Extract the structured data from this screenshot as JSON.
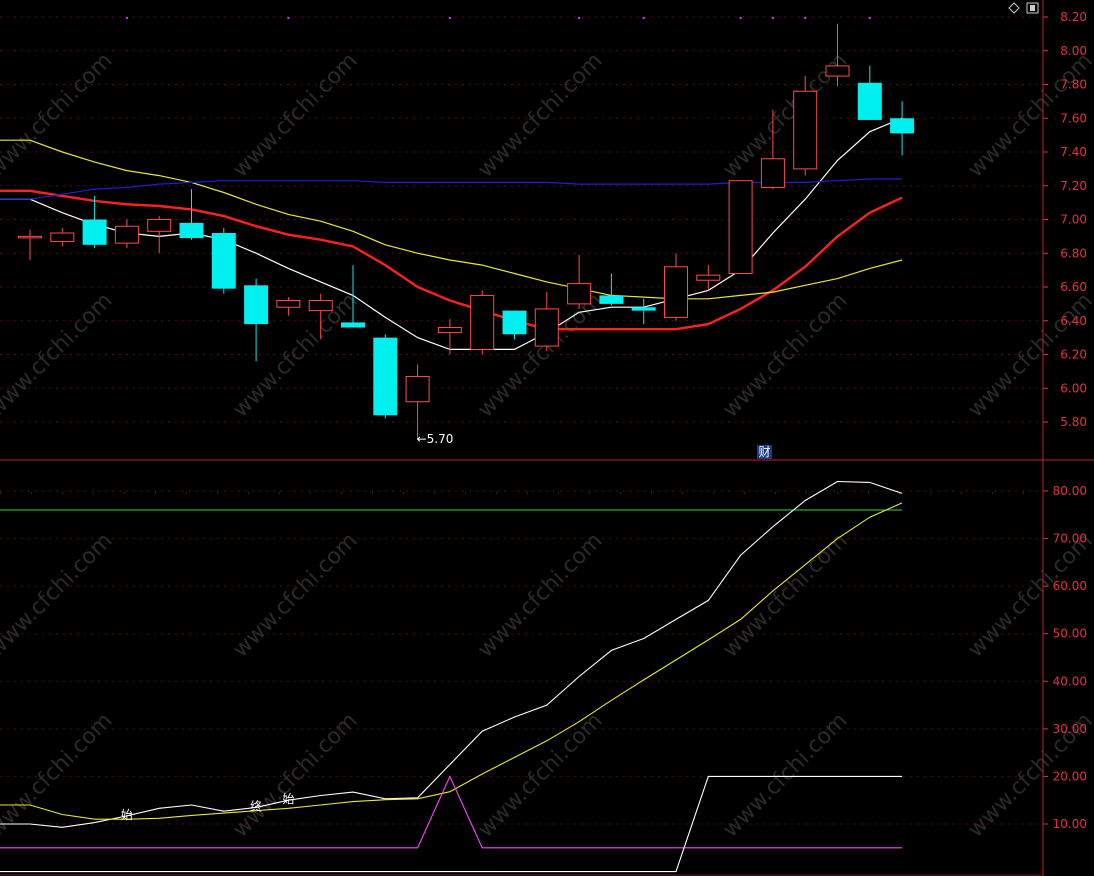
{
  "toolbar": {
    "icons": [
      "diamond-icon",
      "copy-icon"
    ]
  },
  "watermark": "www.cfchi.com",
  "chart_data": [
    {
      "type": "candlestick",
      "panel": "price",
      "ylim": [
        5.62,
        8.25
      ],
      "yticks": [
        "8.20",
        "8.00",
        "7.80",
        "7.60",
        "7.40",
        "7.20",
        "7.00",
        "6.80",
        "6.60",
        "6.40",
        "6.20",
        "6.00",
        "5.80"
      ],
      "candles": [
        {
          "o": 6.9,
          "h": 6.94,
          "l": 6.76,
          "c": 6.9
        },
        {
          "o": 6.87,
          "h": 6.95,
          "l": 6.84,
          "c": 6.92
        },
        {
          "o": 7.0,
          "h": 7.14,
          "l": 6.83,
          "c": 6.85
        },
        {
          "o": 6.86,
          "h": 7.0,
          "l": 6.83,
          "c": 6.96
        },
        {
          "o": 6.93,
          "h": 7.02,
          "l": 6.8,
          "c": 7.0
        },
        {
          "o": 6.98,
          "h": 7.18,
          "l": 6.88,
          "c": 6.89
        },
        {
          "o": 6.92,
          "h": 6.95,
          "l": 6.56,
          "c": 6.59
        },
        {
          "o": 6.61,
          "h": 6.65,
          "l": 6.16,
          "c": 6.38
        },
        {
          "o": 6.48,
          "h": 6.54,
          "l": 6.43,
          "c": 6.52
        },
        {
          "o": 6.46,
          "h": 6.56,
          "l": 6.29,
          "c": 6.52
        },
        {
          "o": 6.39,
          "h": 6.73,
          "l": 6.36,
          "c": 6.36
        },
        {
          "o": 6.3,
          "h": 6.32,
          "l": 5.82,
          "c": 5.84
        },
        {
          "o": 5.92,
          "h": 6.14,
          "l": 5.7,
          "c": 6.07
        },
        {
          "o": 6.33,
          "h": 6.41,
          "l": 6.2,
          "c": 6.36
        },
        {
          "o": 6.23,
          "h": 6.58,
          "l": 6.2,
          "c": 6.55
        },
        {
          "o": 6.46,
          "h": 6.46,
          "l": 6.29,
          "c": 6.32
        },
        {
          "o": 6.25,
          "h": 6.57,
          "l": 6.22,
          "c": 6.47
        },
        {
          "o": 6.5,
          "h": 6.79,
          "l": 6.47,
          "c": 6.62
        },
        {
          "o": 6.55,
          "h": 6.68,
          "l": 6.49,
          "c": 6.5
        },
        {
          "o": 6.48,
          "h": 6.53,
          "l": 6.38,
          "c": 6.46
        },
        {
          "o": 6.42,
          "h": 6.8,
          "l": 6.4,
          "c": 6.72
        },
        {
          "o": 6.64,
          "h": 6.73,
          "l": 6.58,
          "c": 6.67
        },
        {
          "o": 6.68,
          "h": 7.23,
          "l": 6.68,
          "c": 7.23
        },
        {
          "o": 7.19,
          "h": 7.65,
          "l": 7.18,
          "c": 7.36
        },
        {
          "o": 7.3,
          "h": 7.85,
          "l": 7.26,
          "c": 7.76
        },
        {
          "o": 7.85,
          "h": 8.16,
          "l": 7.79,
          "c": 7.91
        },
        {
          "o": 7.81,
          "h": 7.91,
          "l": 7.59,
          "c": 7.59
        },
        {
          "o": 7.6,
          "h": 7.7,
          "l": 7.38,
          "c": 7.51
        }
      ],
      "series": [
        {
          "color": "#ffffff",
          "values": [
            7.12,
            7.04,
            6.97,
            6.92,
            6.9,
            6.92,
            6.88,
            6.8,
            6.71,
            6.63,
            6.55,
            6.42,
            6.3,
            6.23,
            6.23,
            6.23,
            6.33,
            6.45,
            6.48,
            6.48,
            6.53,
            6.58,
            6.7,
            6.92,
            7.12,
            7.35,
            7.52,
            7.6
          ]
        },
        {
          "color": "#ff2020",
          "values": [
            7.17,
            7.14,
            7.11,
            7.09,
            7.08,
            7.06,
            7.02,
            6.96,
            6.91,
            6.88,
            6.84,
            6.73,
            6.6,
            6.52,
            6.46,
            6.4,
            6.35,
            6.35,
            6.35,
            6.35,
            6.35,
            6.38,
            6.47,
            6.58,
            6.72,
            6.9,
            7.04,
            7.13
          ]
        },
        {
          "color": "#e6e63a",
          "values": [
            7.47,
            7.4,
            7.34,
            7.29,
            7.26,
            7.22,
            7.16,
            7.09,
            7.03,
            6.99,
            6.93,
            6.85,
            6.8,
            6.76,
            6.73,
            6.68,
            6.63,
            6.59,
            6.55,
            6.54,
            6.53,
            6.53,
            6.55,
            6.57,
            6.61,
            6.65,
            6.71,
            6.76
          ]
        },
        {
          "color": "#1e1ed2",
          "values": [
            7.12,
            7.15,
            7.18,
            7.19,
            7.21,
            7.22,
            7.23,
            7.23,
            7.23,
            7.23,
            7.23,
            7.22,
            7.22,
            7.22,
            7.22,
            7.22,
            7.22,
            7.21,
            7.21,
            7.21,
            7.21,
            7.21,
            7.22,
            7.22,
            7.22,
            7.23,
            7.24,
            7.24
          ]
        }
      ],
      "low_marker": "←5.70",
      "badge": "财",
      "top_dots": [
        3,
        8,
        13,
        17,
        19,
        22,
        23,
        24,
        26
      ]
    },
    {
      "type": "line",
      "panel": "indicator",
      "ylim": [
        -1,
        85
      ],
      "yticks": [
        "80.00",
        "70.00",
        "60.00",
        "50.00",
        "40.00",
        "30.00",
        "20.00",
        "10.00"
      ],
      "reference_line": {
        "value": 76,
        "color": "#33dd33"
      },
      "series": [
        {
          "color": "#ffffff",
          "values": [
            10,
            9.3,
            10.3,
            11.7,
            13.3,
            14,
            12.7,
            13.5,
            15,
            16,
            16.7,
            15.3,
            15.5,
            22.5,
            29.5,
            32.5,
            35,
            41,
            46.5,
            49,
            53,
            57,
            66.5,
            72.5,
            78,
            82,
            81.8,
            79.5
          ]
        },
        {
          "color": "#e6e63a",
          "values": [
            14,
            12,
            11,
            11,
            11.2,
            11.8,
            12.3,
            12.8,
            13.3,
            14,
            14.7,
            15.1,
            15.3,
            16.8,
            20.5,
            24,
            27.5,
            31.5,
            36,
            40.3,
            44.5,
            48.7,
            53,
            59,
            64.5,
            70,
            74.5,
            77.5
          ]
        },
        {
          "color": "#ff44ff",
          "values": [
            5,
            5,
            5,
            5,
            5,
            5,
            5,
            5,
            5,
            5,
            5,
            5,
            5,
            20,
            5,
            5,
            5,
            5,
            5,
            5,
            5,
            5,
            5,
            5,
            5,
            5,
            5,
            5
          ]
        },
        {
          "color": "#ffffff",
          "values": [
            0,
            0,
            0,
            0,
            0,
            0,
            0,
            0,
            0,
            0,
            0,
            0,
            0,
            0,
            0,
            0,
            0,
            0,
            0,
            0,
            0,
            20,
            20,
            20,
            20,
            20,
            20,
            20
          ]
        }
      ],
      "annotations": [
        {
          "text": "始",
          "index": 3
        },
        {
          "text": "终",
          "index": 7
        },
        {
          "text": "始",
          "index": 8
        }
      ]
    }
  ]
}
